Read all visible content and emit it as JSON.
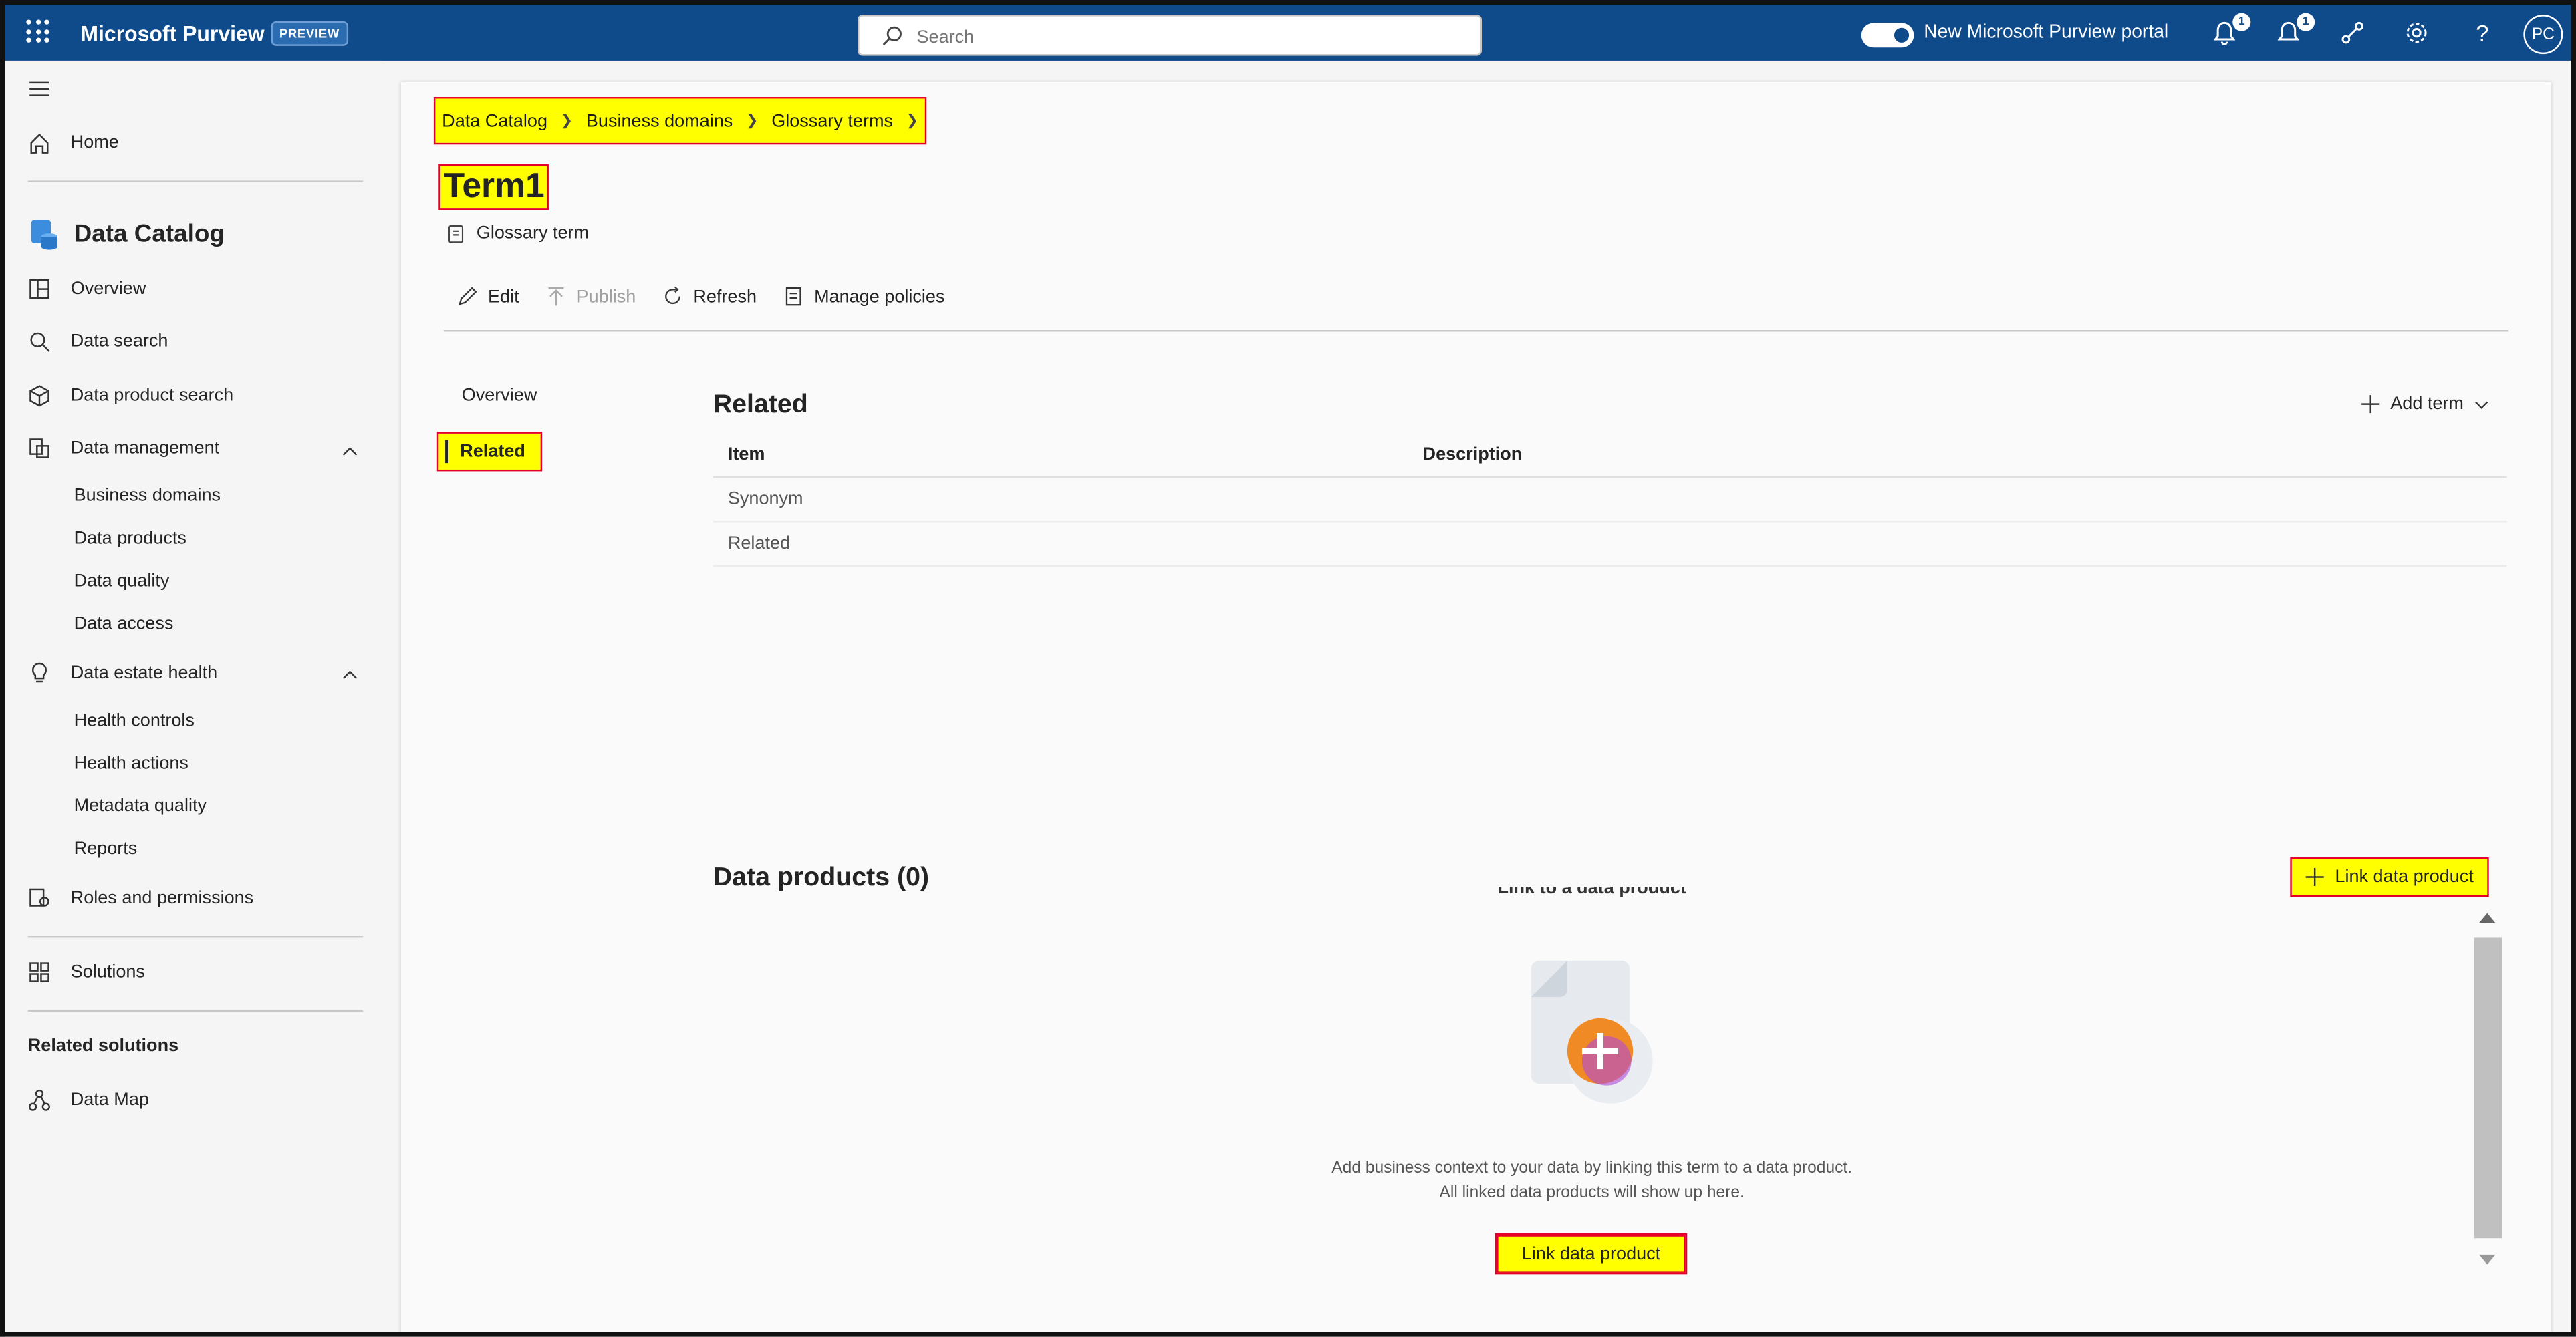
{
  "topbar": {
    "brand": "Microsoft Purview",
    "preview_badge": "PREVIEW",
    "search_placeholder": "Search",
    "portal_label": "New Microsoft Purview portal",
    "notifications_count": "1",
    "alerts_count": "1",
    "avatar_initials": "PC"
  },
  "sidebar": {
    "home": "Home",
    "app_title": "Data Catalog",
    "overview": "Overview",
    "data_search": "Data search",
    "data_product_search": "Data product search",
    "data_management": "Data management",
    "dm_items": [
      "Business domains",
      "Data products",
      "Data quality",
      "Data access"
    ],
    "data_estate_health": "Data estate health",
    "deh_items": [
      "Health controls",
      "Health actions",
      "Metadata quality",
      "Reports"
    ],
    "roles": "Roles and permissions",
    "solutions": "Solutions",
    "related_solutions": "Related solutions",
    "data_map": "Data Map"
  },
  "breadcrumb": [
    "Data Catalog",
    "Business domains",
    "Glossary terms"
  ],
  "term": {
    "title": "Term1",
    "type": "Glossary term"
  },
  "toolbar": {
    "edit": "Edit",
    "publish": "Publish",
    "refresh": "Refresh",
    "manage_policies": "Manage policies"
  },
  "tabs": {
    "overview": "Overview",
    "related": "Related"
  },
  "related": {
    "heading": "Related",
    "add_term": "Add term",
    "columns": [
      "Item",
      "Description"
    ],
    "rows": [
      {
        "item": "Synonym",
        "description": ""
      },
      {
        "item": "Related",
        "description": ""
      }
    ]
  },
  "data_products": {
    "heading": "Data products (0)",
    "link_button": "Link data product",
    "empty_title": "Link to a data product",
    "empty_line1": "Add business context to your data by linking this term to a data product.",
    "empty_line2": "All linked data products will show up here.",
    "empty_button": "Link data product"
  },
  "colors": {
    "topbar": "#0f4a8a",
    "highlight": "#ffff00",
    "highlight_border": "#e4002b"
  }
}
